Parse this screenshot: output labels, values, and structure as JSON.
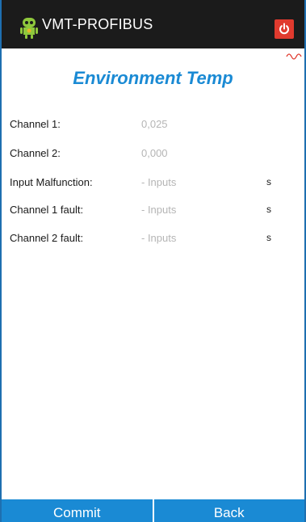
{
  "app": {
    "title": "VMT-PROFIBUS",
    "icon": "android-robot-icon",
    "power_icon": "power-icon",
    "signal_icon": "wave-icon"
  },
  "page": {
    "title": "Environment Temp"
  },
  "rows": [
    {
      "label": "Channel 1:",
      "value": "0,025",
      "unit": ""
    },
    {
      "label": "Channel 2:",
      "value": "0,000",
      "unit": ""
    },
    {
      "label": "Input Malfunction:",
      "value": "- Inputs",
      "unit": "s"
    },
    {
      "label": "Channel 1 fault:",
      "value": "- Inputs",
      "unit": "s"
    },
    {
      "label": "Channel 2 fault:",
      "value": "- Inputs",
      "unit": "s"
    }
  ],
  "buttons": {
    "commit": "Commit",
    "back": "Back"
  },
  "colors": {
    "titlebar": "#1b1b1b",
    "accent": "#1a8ad4",
    "power": "#e03a2e",
    "value_text": "#b5b5b5"
  }
}
